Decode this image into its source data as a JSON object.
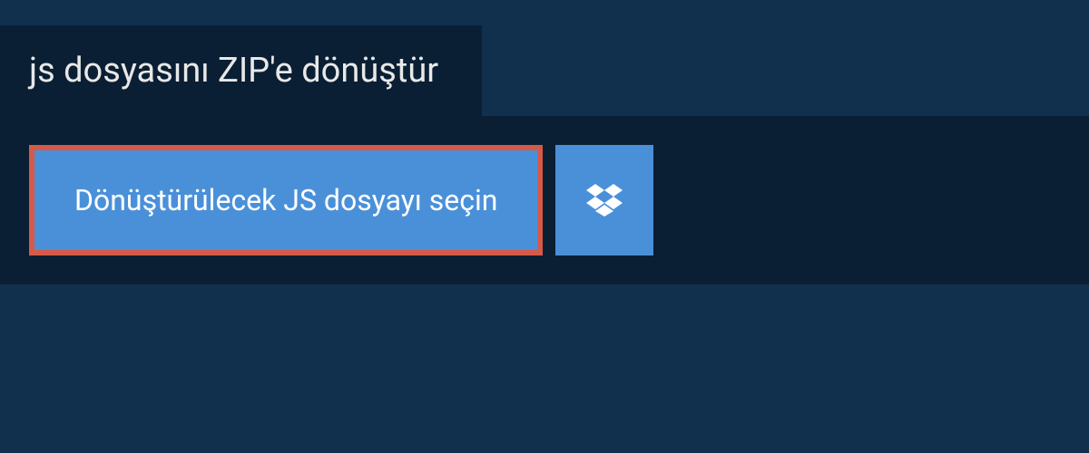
{
  "header": {
    "title": "js dosyasını ZIP'e dönüştür"
  },
  "actions": {
    "select_file_label": "Dönüştürülecek JS dosyayı seçin"
  }
}
